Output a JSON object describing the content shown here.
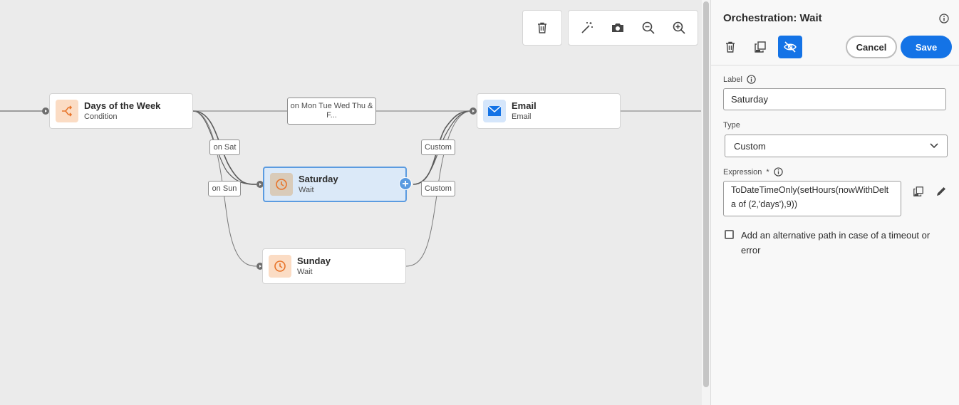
{
  "toolbar": {
    "delete": "trash-icon",
    "tools": [
      "magic-wand-icon",
      "camera-icon",
      "zoom-out-icon",
      "zoom-in-icon"
    ]
  },
  "nodes": {
    "condition": {
      "title": "Days of the Week",
      "subtitle": "Condition"
    },
    "email": {
      "title": "Email",
      "subtitle": "Email"
    },
    "saturday": {
      "title": "Saturday",
      "subtitle": "Wait"
    },
    "sunday": {
      "title": "Sunday",
      "subtitle": "Wait"
    }
  },
  "edges": {
    "weekdays": "on Mon Tue Wed Thu & F...",
    "sat": "on Sat",
    "sun": "on Sun",
    "custom_top": "Custom",
    "custom_bottom": "Custom"
  },
  "panel": {
    "title": "Orchestration: Wait",
    "cancel_label": "Cancel",
    "save_label": "Save",
    "label_field": {
      "label": "Label",
      "value": "Saturday"
    },
    "type_field": {
      "label": "Type",
      "value": "Custom"
    },
    "expression_field": {
      "label": "Expression",
      "required_mark": "*",
      "value": "ToDateTimeOnly(setHours(nowWithDelta of (2,'days'),9))"
    },
    "alt_path": {
      "label": "Add an alternative path in case of a timeout or error",
      "checked": false
    }
  },
  "colors": {
    "accent": "#1473e6",
    "selected_node_bg": "#dbe9f8",
    "condition_icon": "#e8742a",
    "email_icon": "#1473e6",
    "wait_icon": "#e8742a"
  }
}
